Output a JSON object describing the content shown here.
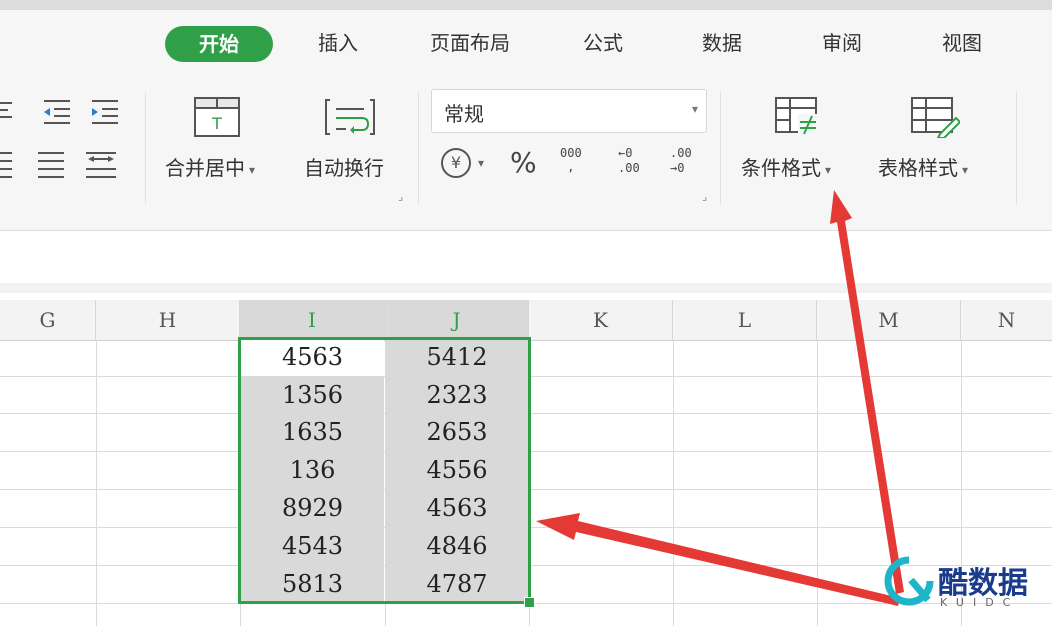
{
  "tabs": [
    {
      "label": "开始",
      "active": true
    },
    {
      "label": "插入"
    },
    {
      "label": "页面布局"
    },
    {
      "label": "公式"
    },
    {
      "label": "数据"
    },
    {
      "label": "审阅"
    },
    {
      "label": "视图"
    }
  ],
  "ribbon": {
    "merge_center": "合并居中",
    "wrap_text": "自动换行",
    "number_format": "常规",
    "percent": "%",
    "conditional_format": "条件格式",
    "table_style": "表格样式",
    "thousands": "000",
    "inc_decimal_top": "←0",
    "inc_decimal_bottom": ".00",
    "dec_decimal_top": ".00",
    "dec_decimal_bottom": "→0",
    "currency": "¥"
  },
  "columns": [
    "G",
    "H",
    "I",
    "J",
    "K",
    "L",
    "M",
    "N"
  ],
  "cells": {
    "I": [
      "4563",
      "1356",
      "1635",
      "136",
      "8929",
      "4543",
      "5813"
    ],
    "J": [
      "5412",
      "2323",
      "2653",
      "4556",
      "4563",
      "4846",
      "4787"
    ]
  },
  "colors": {
    "accent": "#2f9f48",
    "arrow": "#e53935",
    "selection_fill": "#d9d9d9"
  },
  "watermark": {
    "title": "酷数据",
    "sub": "KUIDC"
  }
}
